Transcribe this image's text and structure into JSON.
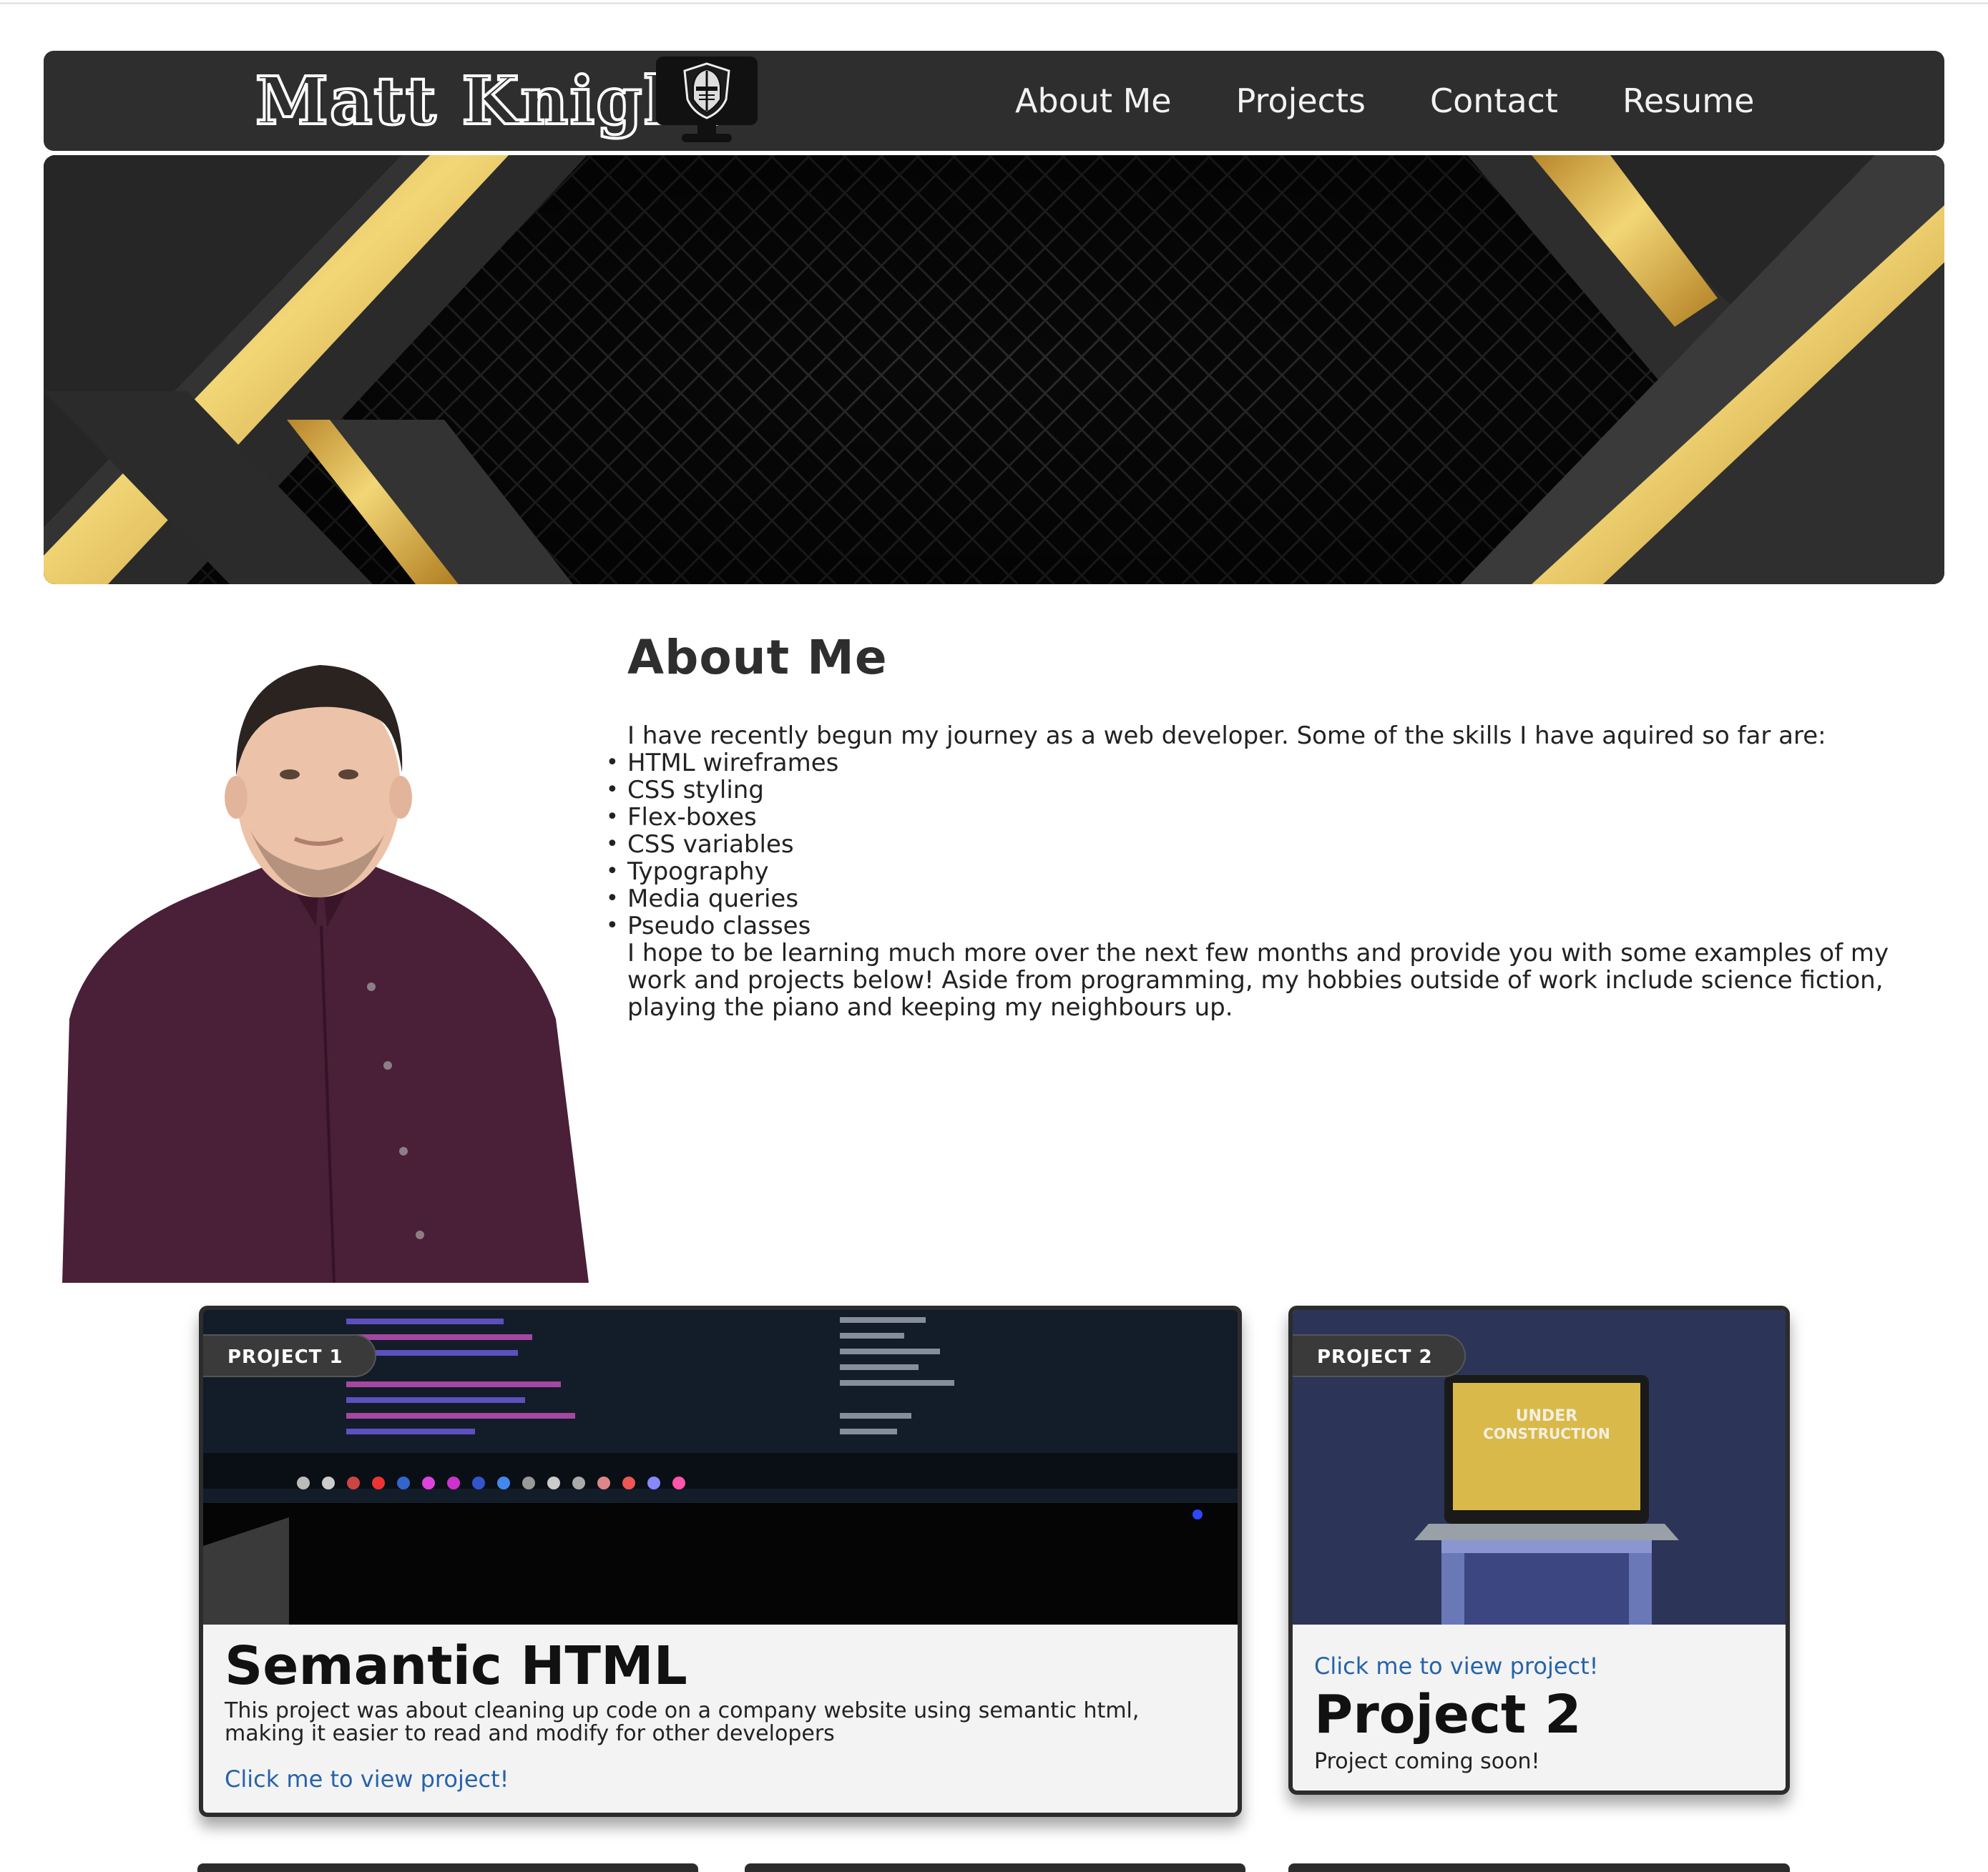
{
  "site": {
    "logo_text": "Matt Knight",
    "logo_icon": "knight-helmet-monitor-icon"
  },
  "nav": {
    "items": [
      {
        "label": "About Me"
      },
      {
        "label": "Projects"
      },
      {
        "label": "Contact"
      },
      {
        "label": "Resume"
      }
    ]
  },
  "about": {
    "heading": "About Me",
    "intro": "I have recently begun my journey as a web developer. Some of the skills I have aquired so far are:",
    "skills": [
      "HTML wireframes",
      "CSS styling",
      "Flex-boxes",
      "CSS variables",
      "Typography",
      "Media queries",
      "Pseudo classes"
    ],
    "outro": "I hope to be learning much more over the next few months and provide you with some examples of my work and projects below! Aside from programming, my hobbies outside of work include science fiction, playing the piano and keeping my neighbours up."
  },
  "projects": [
    {
      "tag": "PROJECT 1",
      "title": "Semantic HTML",
      "description": "This project was about cleaning up code on a company website using semantic html, making it easier to read and modify for other developers",
      "link": "Click me to view project!"
    },
    {
      "tag": "PROJECT 2",
      "title": "Project 2",
      "description": "Project coming soon!",
      "link": "Click me to view project!",
      "image_text": [
        "UNDER",
        "CONSTRUCTION"
      ]
    }
  ],
  "colors": {
    "nav_bg": "#2e2e2e",
    "gold": "#e8c45a",
    "link": "#2763a8",
    "card_bg": "#f3f3f3"
  }
}
